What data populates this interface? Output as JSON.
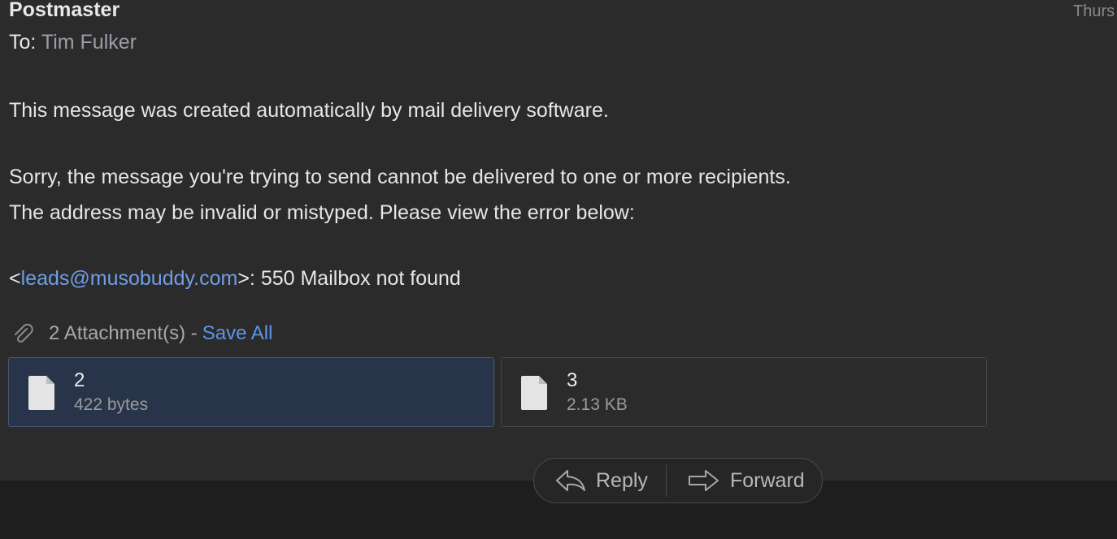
{
  "header": {
    "sender": "Postmaster",
    "date": "Thurs",
    "to_label": "To:",
    "to_name": "Tim Fulker"
  },
  "body": {
    "line1": "This message was created automatically by mail delivery software.",
    "line2": "Sorry, the message you're trying to send cannot be delivered to one or more recipients.",
    "line3": "The address may be invalid or mistyped. Please view the error below:",
    "error_prefix": "<",
    "error_email": "leads@musobuddy.com",
    "error_suffix": ">: 550 Mailbox not found"
  },
  "attachments": {
    "summary": "2 Attachment(s) -",
    "save_all": "Save All",
    "items": [
      {
        "name": "2",
        "size": "422 bytes",
        "selected": true
      },
      {
        "name": "3",
        "size": "2.13 KB",
        "selected": false
      }
    ]
  },
  "actions": {
    "reply": "Reply",
    "forward": "Forward"
  },
  "colors": {
    "background": "#2b2b2b",
    "link": "#6f9ee8",
    "selected_attachment": "#28344a"
  }
}
